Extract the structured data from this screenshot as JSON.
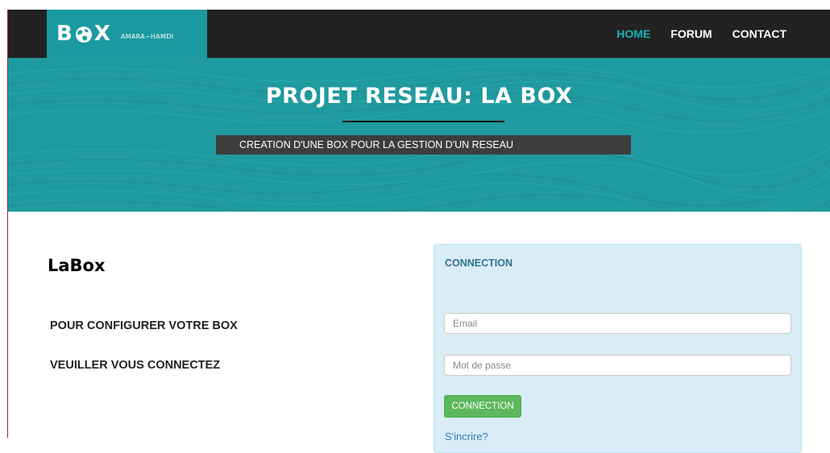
{
  "navbar": {
    "brand_logo": "B X",
    "brand_subtitle": "AMARA~HAMDI",
    "links": [
      {
        "label": "HOME",
        "active": true
      },
      {
        "label": "FORUM",
        "active": false
      },
      {
        "label": "CONTACT",
        "active": false
      }
    ],
    "accent_color": "#1a9aa0"
  },
  "hero": {
    "title": "PROJET RESEAU: LA BOX",
    "subtitle": "CREATION D'UNE BOX POUR LA GESTION D'UN RESEAU"
  },
  "intro": {
    "title": "LaBox",
    "line1": "POUR CONFIGURER VOTRE BOX",
    "line2": "VEUILLER VOUS CONNECTEZ"
  },
  "login": {
    "heading": "CONNECTION",
    "email_placeholder": "Email",
    "password_placeholder": "Mot de passe",
    "submit_label": "CONNECTION",
    "signup_link": "S'incrire?"
  }
}
